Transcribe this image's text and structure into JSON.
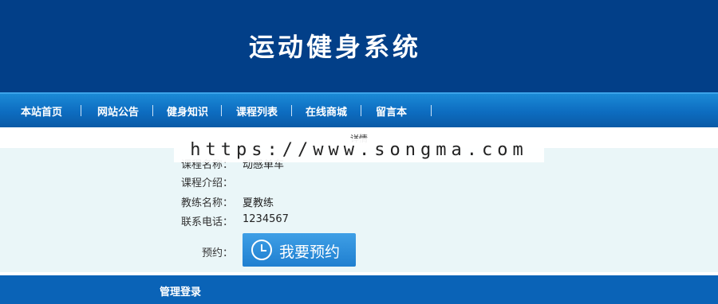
{
  "header": {
    "title": "运动健身系统"
  },
  "nav": {
    "items": [
      "本站首页",
      "网站公告",
      "健身知识",
      "课程列表",
      "在线商城",
      "留言本"
    ]
  },
  "detail": {
    "title": "详情",
    "course_name_label": "课程名称：",
    "course_name_value": "动感单车",
    "course_intro_label": "课程介绍：",
    "course_intro_value": "",
    "coach_label": "教练名称：",
    "coach_value": "夏教练",
    "phone_label": "联系电话：",
    "phone_value": "1234567",
    "booking_label": "预约：",
    "booking_button": "我要预约"
  },
  "watermark": {
    "text": "https://www.songma.com"
  },
  "footer": {
    "admin_login": "管理登录"
  },
  "colors": {
    "banner": "#023f88",
    "nav": "#0d6cc0",
    "content_bg": "#eaf6f8",
    "button": "#2b8ad9",
    "footer": "#0a63b7"
  },
  "icons": {
    "booking": "clock-icon"
  }
}
